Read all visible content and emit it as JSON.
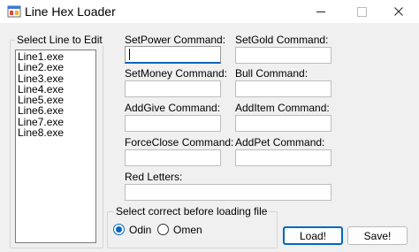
{
  "window": {
    "title": "Line Hex Loader",
    "icon": "app-icon",
    "controls": {
      "minimize": "minimize-icon",
      "maximize": "maximize-icon",
      "close": "close-icon"
    }
  },
  "line_group": {
    "legend": "Select Line to Edit",
    "items": [
      "Line1.exe",
      "Line2.exe",
      "Line3.exe",
      "Line4.exe",
      "Line5.exe",
      "Line6.exe",
      "Line7.exe",
      "Line8.exe"
    ]
  },
  "fields": {
    "setpower": {
      "label": "SetPower Command:",
      "value": ""
    },
    "setgold": {
      "label": "SetGold Command:",
      "value": ""
    },
    "setmoney": {
      "label": "SetMoney Command:",
      "value": ""
    },
    "bull": {
      "label": "Bull Command:",
      "value": ""
    },
    "addgive": {
      "label": "AddGive Command:",
      "value": ""
    },
    "additem": {
      "label": "AddItem Command:",
      "value": ""
    },
    "forceclose": {
      "label": "ForceClose Command:",
      "value": ""
    },
    "addpet": {
      "label": "AddPet Command:",
      "value": ""
    },
    "redletters": {
      "label": "Red Letters:",
      "value": ""
    }
  },
  "file_group": {
    "legend": "Select correct before loading file",
    "options": [
      {
        "label": "Odin",
        "selected": true
      },
      {
        "label": "Omen",
        "selected": false
      }
    ]
  },
  "buttons": {
    "load": "Load!",
    "save": "Save!"
  },
  "colors": {
    "accent": "#0067c0",
    "window_bg": "#f0f0f0"
  }
}
